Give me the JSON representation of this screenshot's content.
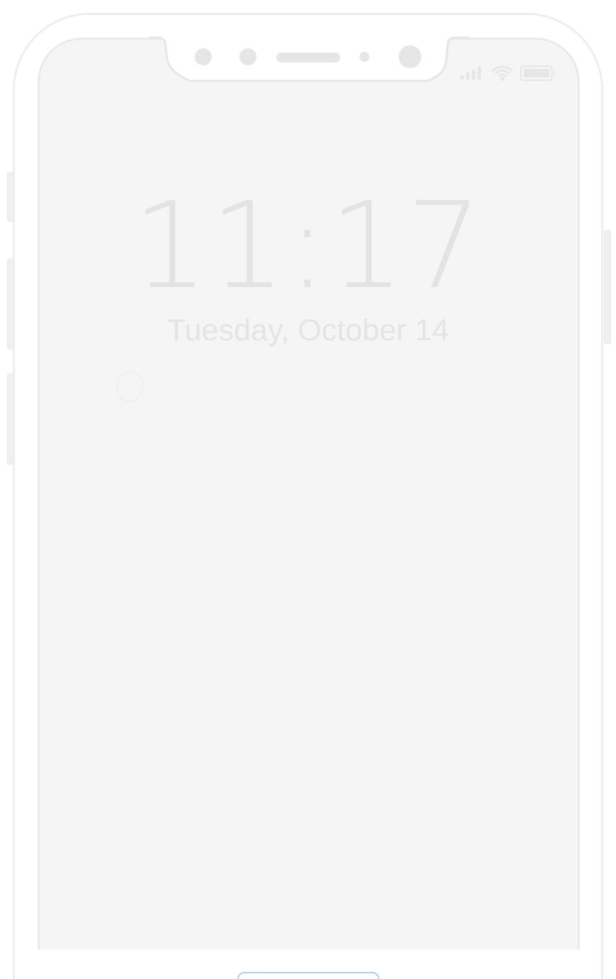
{
  "lock_screen": {
    "time": "11:17",
    "date": "Tuesday, October 14"
  },
  "status_bar": {
    "icons": [
      "cellular-signal-icon",
      "wifi-icon",
      "battery-icon"
    ]
  },
  "device": {
    "icons": [
      "front-camera-icon",
      "proximity-sensor-icon",
      "earpiece-speaker-icon",
      "ambient-light-sensor-icon",
      "dot-projector-icon"
    ]
  },
  "colors": {
    "screen_background": "#f5f5f5",
    "frame": "#eeeeee",
    "text": "#e3e3e3",
    "home_tab_border": "#b9cbe0"
  }
}
